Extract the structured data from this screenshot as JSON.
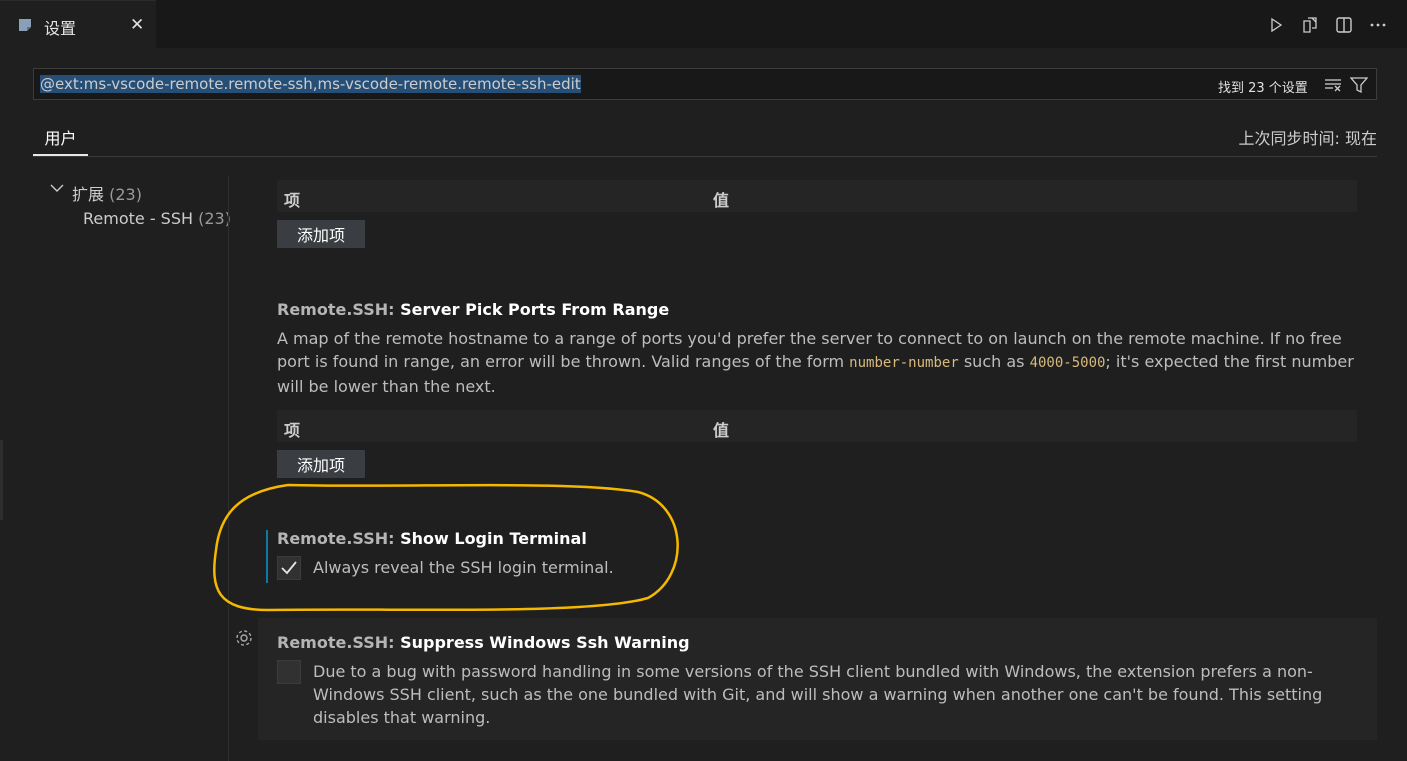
{
  "tab": {
    "title": "设置",
    "icon": "settings-file-icon",
    "close": "✕"
  },
  "editor_actions": [
    "run-icon",
    "open-json-icon",
    "split-editor-icon",
    "more-icon"
  ],
  "search": {
    "value": "@ext:ms-vscode-remote.remote-ssh,ms-vscode-remote.remote-ssh-edit",
    "result_count": "找到 23 个设置"
  },
  "scope": {
    "user_tab": "用户",
    "last_sync": "上次同步时间: 现在"
  },
  "toc": {
    "extensions_label": "扩展",
    "extensions_count": "(23)",
    "item_label": "Remote - SSH",
    "item_count": "(23)"
  },
  "table": {
    "col_item": "项",
    "col_value": "值",
    "add_button": "添加项"
  },
  "settings": [
    {
      "category": "Remote.SSH: ",
      "name": "Server Pick Ports From Range",
      "desc_1": "A map of the remote hostname to a range of ports you'd prefer the server to connect to on launch on the remote machine. If no free port is found in range, an error will be thrown. Valid ranges of the form ",
      "code_1": "number-number",
      "desc_2": " such as ",
      "code_2": "4000-5000",
      "desc_3": "; it's expected the first number will be lower than the next."
    },
    {
      "category": "Remote.SSH: ",
      "name": "Show Login Terminal",
      "checkbox_label": "Always reveal the SSH login terminal.",
      "checked": true
    },
    {
      "category": "Remote.SSH: ",
      "name": "Suppress Windows Ssh Warning",
      "checkbox_label": "Due to a bug with password handling in some versions of the SSH client bundled with Windows, the extension prefers a non-Windows SSH client, such as the one bundled with Git, and will show a warning when another one can't be found. This setting disables that warning.",
      "checked": false
    }
  ],
  "colors": {
    "accent": "#0e7aa3",
    "annotation": "#f5b800",
    "code": "#d7ba7d"
  }
}
